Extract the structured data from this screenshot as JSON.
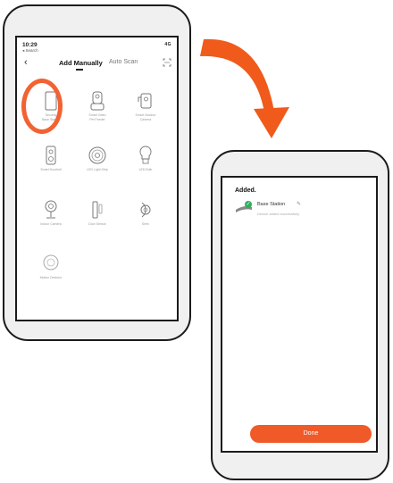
{
  "phone1": {
    "status": {
      "time": "10:29",
      "back_label": "◂ Search",
      "signal": "4G"
    },
    "nav": {
      "back_icon": "chevron-left-icon",
      "tab_active": "Add Manually",
      "tab_inactive": "Auto Scan",
      "scan_icon": "scan-icon"
    },
    "devices": [
      {
        "label": "Security\nBase Station",
        "icon": "base-station-icon"
      },
      {
        "label": "Smart Video\nPet Feeder",
        "icon": "pet-feeder-icon"
      },
      {
        "label": "Smart Outdoor\nCamera",
        "icon": "outdoor-camera-icon"
      },
      {
        "label": "Smart Doorbell",
        "icon": "doorbell-icon"
      },
      {
        "label": "LED Light Strip",
        "icon": "light-strip-icon"
      },
      {
        "label": "LED Bulb",
        "icon": "bulb-icon"
      },
      {
        "label": "Indoor Camera",
        "icon": "indoor-camera-icon"
      },
      {
        "label": "Door Sensor",
        "icon": "door-sensor-icon"
      },
      {
        "label": "Siren",
        "icon": "siren-icon"
      },
      {
        "label": "Motion Detector",
        "icon": "motion-detector-icon"
      }
    ],
    "highlight_color": "#f26232"
  },
  "arrow_color": "#f05a1a",
  "phone2": {
    "title": "Added.",
    "device": {
      "name": "Base Station",
      "status": "Device added successfully",
      "edit_icon": "pencil-icon",
      "check_icon": "check-icon"
    },
    "done_label": "Done",
    "accent": "#f05a28"
  }
}
